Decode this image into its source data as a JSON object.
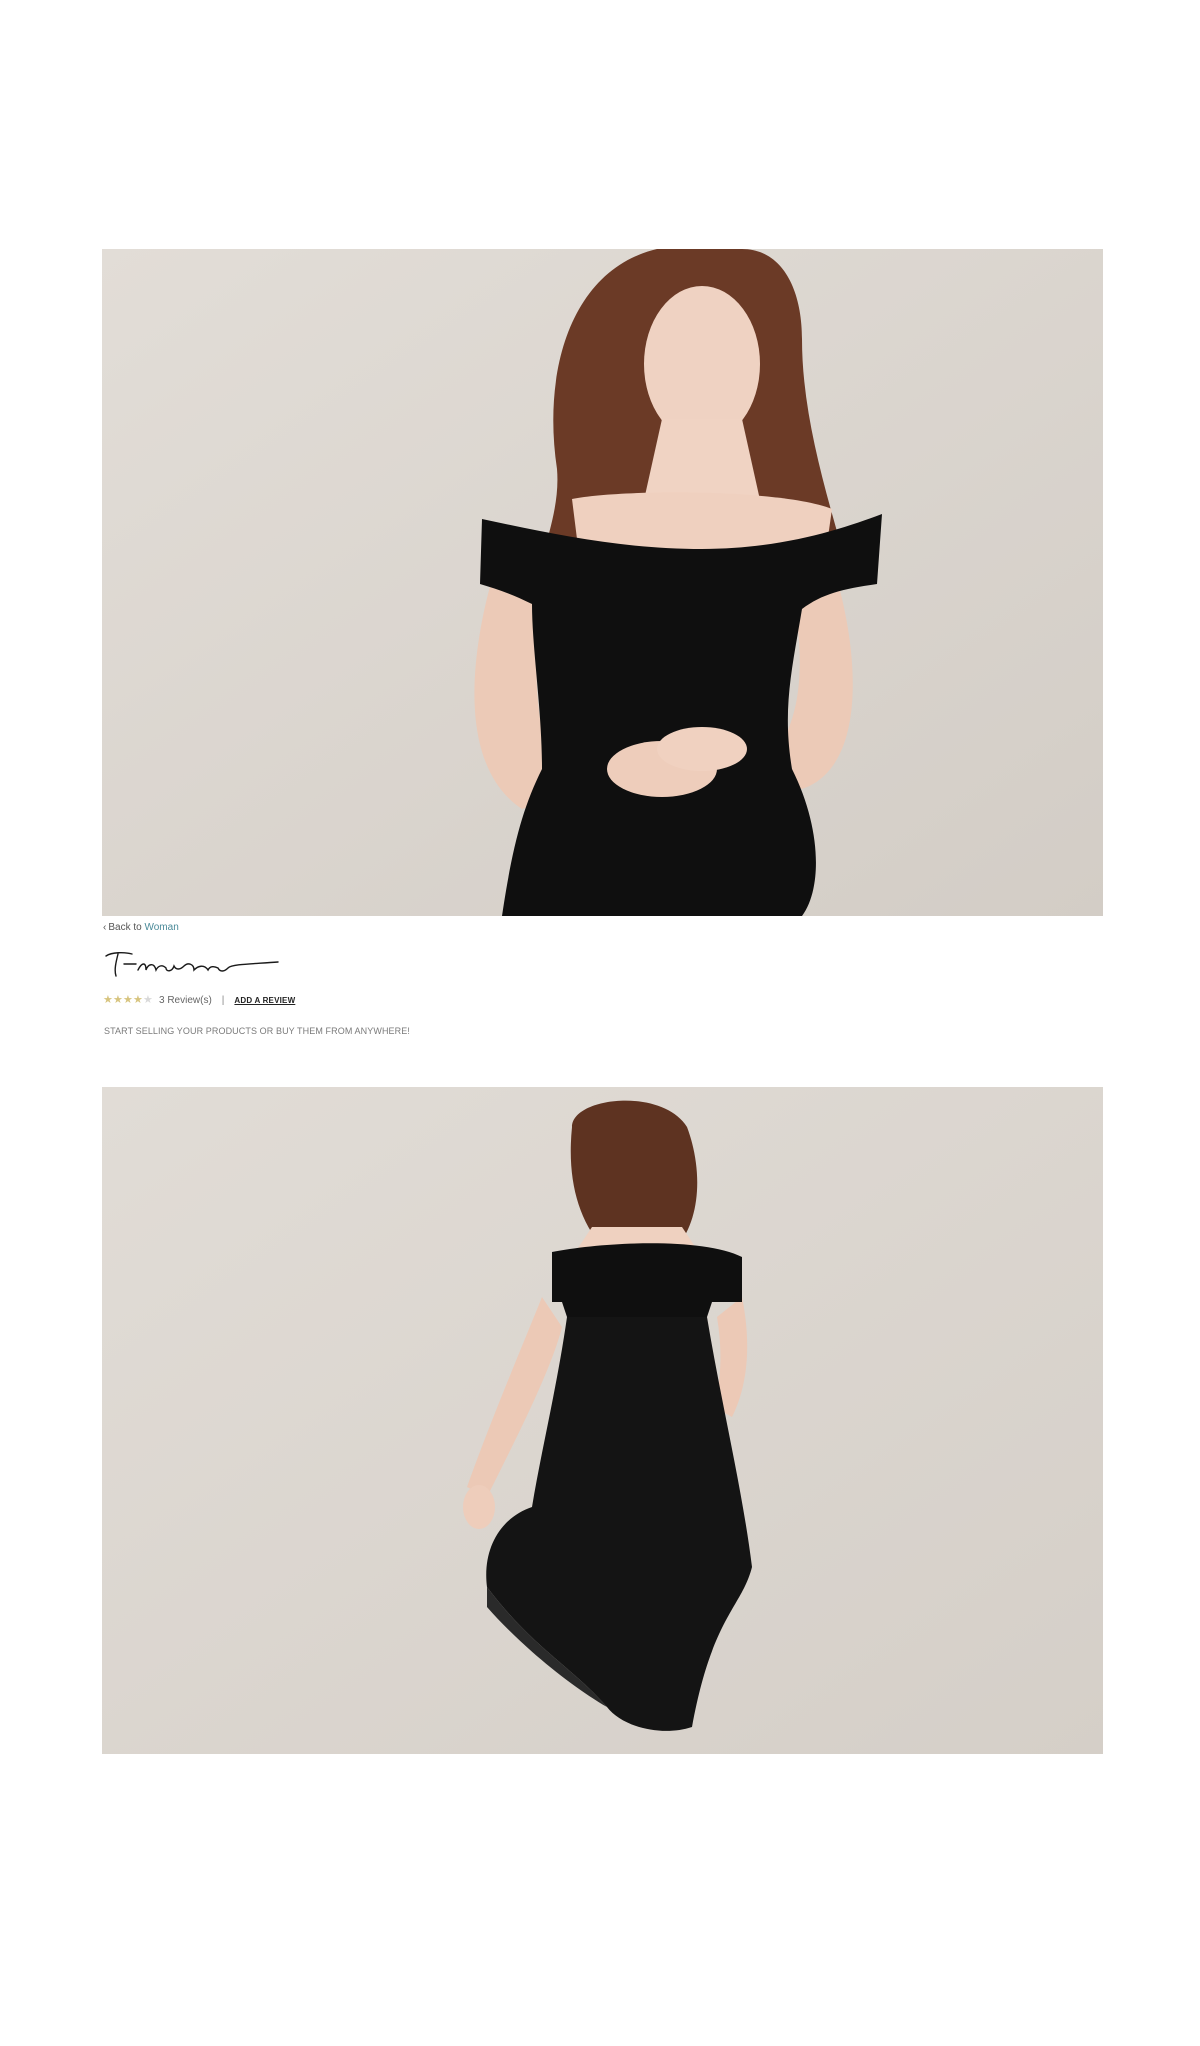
{
  "product_gallery": {
    "front_image_alt": "",
    "back_image_alt": ""
  },
  "breadcrumb": {
    "prefix": "Back to",
    "category": "Woman"
  },
  "brand": {
    "logo_text": "T-nani"
  },
  "reviews": {
    "rating": 4,
    "max_rating": 5,
    "count_label": "3 Review(s)",
    "separator": "|",
    "add_review_label": "ADD A REVIEW"
  },
  "tagline": "START SELLING YOUR PRODUCTS OR BUY THEM FROM ANYWHERE!",
  "colors": {
    "link_accent": "#4a8a99",
    "star_filled": "#d7c47e",
    "star_empty": "#d9d9d9",
    "photo_background": "#dcd7d1"
  }
}
